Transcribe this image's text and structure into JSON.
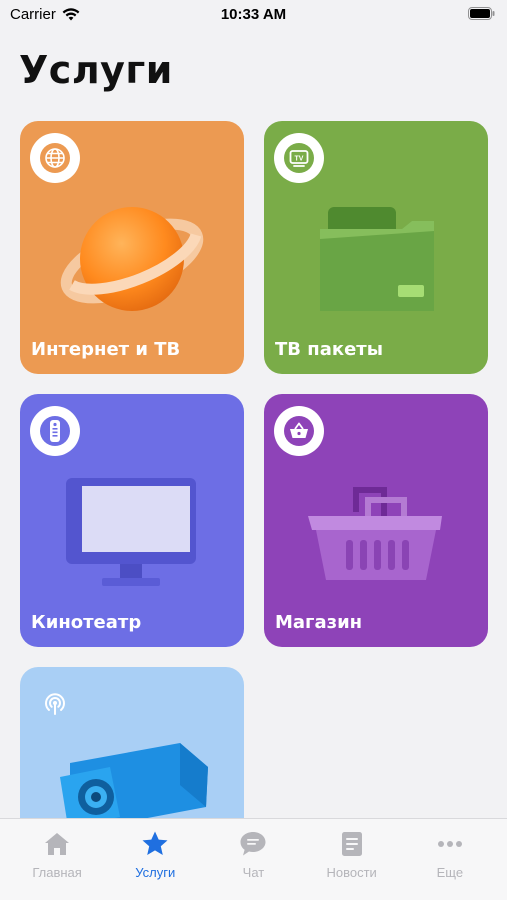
{
  "status_bar": {
    "carrier": "Carrier",
    "time": "10:33 AM"
  },
  "page": {
    "title": "Услуги"
  },
  "cards": [
    {
      "label": "Интернет и ТВ",
      "color": "#ec9a52",
      "icon": "globe-icon"
    },
    {
      "label": "ТВ пакеты",
      "color": "#7aac48",
      "icon": "tv-icon",
      "badge_text": "TV"
    },
    {
      "label": "Кинотеатр",
      "color": "#6d6ee5",
      "icon": "remote-icon"
    },
    {
      "label": "Магазин",
      "color": "#8e43b8",
      "icon": "basket-icon"
    },
    {
      "label": "",
      "color": "#a9cff5",
      "icon": "broadcast-icon"
    }
  ],
  "tab_bar": {
    "active_color": "#1f6fe0",
    "items": [
      {
        "label": "Главная",
        "icon": "home-icon"
      },
      {
        "label": "Услуги",
        "icon": "star-icon",
        "active": true
      },
      {
        "label": "Чат",
        "icon": "chat-icon"
      },
      {
        "label": "Новости",
        "icon": "news-icon"
      },
      {
        "label": "Еще",
        "icon": "more-icon"
      }
    ]
  }
}
